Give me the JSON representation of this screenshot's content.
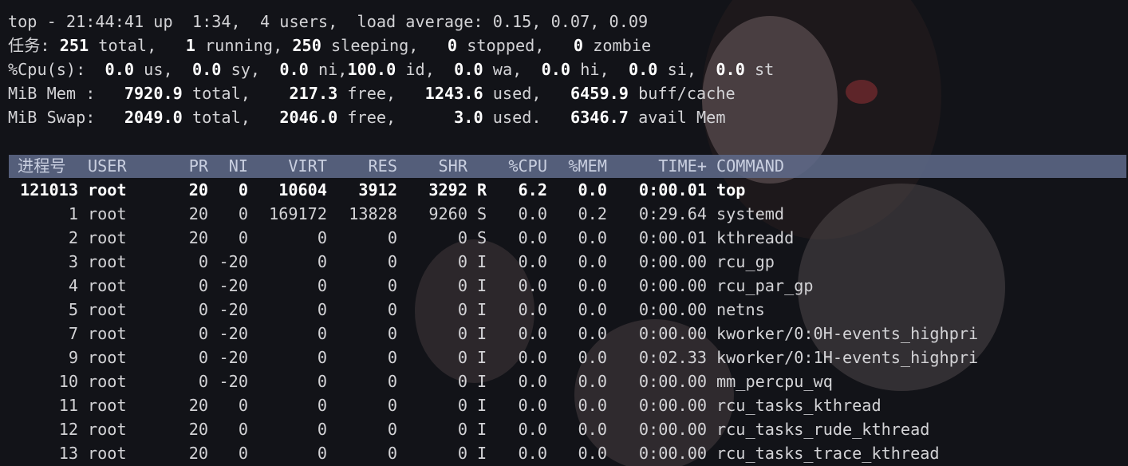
{
  "summary": {
    "line1": "top - 21:44:41 up  1:34,  4 users,  load average: 0.15, 0.07, 0.09",
    "tasks": [
      {
        "text": "任务: ",
        "bold": false
      },
      {
        "text": "251",
        "bold": true
      },
      {
        "text": " total,   ",
        "bold": false
      },
      {
        "text": "1",
        "bold": true
      },
      {
        "text": " running, ",
        "bold": false
      },
      {
        "text": "250",
        "bold": true
      },
      {
        "text": " sleeping,   ",
        "bold": false
      },
      {
        "text": "0",
        "bold": true
      },
      {
        "text": " stopped,   ",
        "bold": false
      },
      {
        "text": "0",
        "bold": true
      },
      {
        "text": " zombie",
        "bold": false
      }
    ],
    "cpu": [
      {
        "text": "%Cpu(s):  ",
        "bold": false
      },
      {
        "text": "0.0",
        "bold": true
      },
      {
        "text": " us,  ",
        "bold": false
      },
      {
        "text": "0.0",
        "bold": true
      },
      {
        "text": " sy,  ",
        "bold": false
      },
      {
        "text": "0.0",
        "bold": true
      },
      {
        "text": " ni,",
        "bold": false
      },
      {
        "text": "100.0",
        "bold": true
      },
      {
        "text": " id,  ",
        "bold": false
      },
      {
        "text": "0.0",
        "bold": true
      },
      {
        "text": " wa,  ",
        "bold": false
      },
      {
        "text": "0.0",
        "bold": true
      },
      {
        "text": " hi,  ",
        "bold": false
      },
      {
        "text": "0.0",
        "bold": true
      },
      {
        "text": " si,  ",
        "bold": false
      },
      {
        "text": "0.0",
        "bold": true
      },
      {
        "text": " st",
        "bold": false
      }
    ],
    "mem": [
      {
        "text": "MiB Mem :   ",
        "bold": false
      },
      {
        "text": "7920.9",
        "bold": true
      },
      {
        "text": " total,    ",
        "bold": false
      },
      {
        "text": "217.3",
        "bold": true
      },
      {
        "text": " free,   ",
        "bold": false
      },
      {
        "text": "1243.6",
        "bold": true
      },
      {
        "text": " used,   ",
        "bold": false
      },
      {
        "text": "6459.9",
        "bold": true
      },
      {
        "text": " buff/cache",
        "bold": false
      }
    ],
    "swap": [
      {
        "text": "MiB Swap:   ",
        "bold": false
      },
      {
        "text": "2049.0",
        "bold": true
      },
      {
        "text": " total,   ",
        "bold": false
      },
      {
        "text": "2046.0",
        "bold": true
      },
      {
        "text": " free,      ",
        "bold": false
      },
      {
        "text": "3.0",
        "bold": true
      },
      {
        "text": " used.   ",
        "bold": false
      },
      {
        "text": "6346.7",
        "bold": true
      },
      {
        "text": " avail Mem",
        "bold": false
      }
    ]
  },
  "columns": {
    "pid": "进程号",
    "user": "USER",
    "pr": "PR",
    "ni": "NI",
    "virt": "VIRT",
    "res": "RES",
    "shr": "SHR",
    "s": "",
    "cpu": "%CPU",
    "mem": "%MEM",
    "time": "TIME+",
    "cmd": "COMMAND"
  },
  "processes": [
    {
      "pid": "121013",
      "user": "root",
      "pr": "20",
      "ni": "0",
      "virt": "10604",
      "res": "3912",
      "shr": "3292",
      "s": "R",
      "cpu": "6.2",
      "mem": "0.0",
      "time": "0:00.01",
      "cmd": "top",
      "hot": true
    },
    {
      "pid": "1",
      "user": "root",
      "pr": "20",
      "ni": "0",
      "virt": "169172",
      "res": "13828",
      "shr": "9260",
      "s": "S",
      "cpu": "0.0",
      "mem": "0.2",
      "time": "0:29.64",
      "cmd": "systemd"
    },
    {
      "pid": "2",
      "user": "root",
      "pr": "20",
      "ni": "0",
      "virt": "0",
      "res": "0",
      "shr": "0",
      "s": "S",
      "cpu": "0.0",
      "mem": "0.0",
      "time": "0:00.01",
      "cmd": "kthreadd"
    },
    {
      "pid": "3",
      "user": "root",
      "pr": "0",
      "ni": "-20",
      "virt": "0",
      "res": "0",
      "shr": "0",
      "s": "I",
      "cpu": "0.0",
      "mem": "0.0",
      "time": "0:00.00",
      "cmd": "rcu_gp"
    },
    {
      "pid": "4",
      "user": "root",
      "pr": "0",
      "ni": "-20",
      "virt": "0",
      "res": "0",
      "shr": "0",
      "s": "I",
      "cpu": "0.0",
      "mem": "0.0",
      "time": "0:00.00",
      "cmd": "rcu_par_gp"
    },
    {
      "pid": "5",
      "user": "root",
      "pr": "0",
      "ni": "-20",
      "virt": "0",
      "res": "0",
      "shr": "0",
      "s": "I",
      "cpu": "0.0",
      "mem": "0.0",
      "time": "0:00.00",
      "cmd": "netns"
    },
    {
      "pid": "7",
      "user": "root",
      "pr": "0",
      "ni": "-20",
      "virt": "0",
      "res": "0",
      "shr": "0",
      "s": "I",
      "cpu": "0.0",
      "mem": "0.0",
      "time": "0:00.00",
      "cmd": "kworker/0:0H-events_highpri"
    },
    {
      "pid": "9",
      "user": "root",
      "pr": "0",
      "ni": "-20",
      "virt": "0",
      "res": "0",
      "shr": "0",
      "s": "I",
      "cpu": "0.0",
      "mem": "0.0",
      "time": "0:02.33",
      "cmd": "kworker/0:1H-events_highpri"
    },
    {
      "pid": "10",
      "user": "root",
      "pr": "0",
      "ni": "-20",
      "virt": "0",
      "res": "0",
      "shr": "0",
      "s": "I",
      "cpu": "0.0",
      "mem": "0.0",
      "time": "0:00.00",
      "cmd": "mm_percpu_wq"
    },
    {
      "pid": "11",
      "user": "root",
      "pr": "20",
      "ni": "0",
      "virt": "0",
      "res": "0",
      "shr": "0",
      "s": "I",
      "cpu": "0.0",
      "mem": "0.0",
      "time": "0:00.00",
      "cmd": "rcu_tasks_kthread"
    },
    {
      "pid": "12",
      "user": "root",
      "pr": "20",
      "ni": "0",
      "virt": "0",
      "res": "0",
      "shr": "0",
      "s": "I",
      "cpu": "0.0",
      "mem": "0.0",
      "time": "0:00.00",
      "cmd": "rcu_tasks_rude_kthread"
    },
    {
      "pid": "13",
      "user": "root",
      "pr": "20",
      "ni": "0",
      "virt": "0",
      "res": "0",
      "shr": "0",
      "s": "I",
      "cpu": "0.0",
      "mem": "0.0",
      "time": "0:00.00",
      "cmd": "rcu_tasks_trace_kthread"
    }
  ]
}
